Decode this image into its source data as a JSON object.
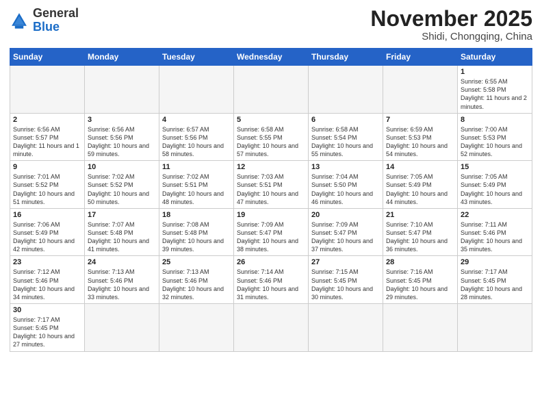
{
  "logo": {
    "general": "General",
    "blue": "Blue"
  },
  "title": "November 2025",
  "location": "Shidi, Chongqing, China",
  "weekdays": [
    "Sunday",
    "Monday",
    "Tuesday",
    "Wednesday",
    "Thursday",
    "Friday",
    "Saturday"
  ],
  "days": [
    {
      "date": "",
      "info": ""
    },
    {
      "date": "",
      "info": ""
    },
    {
      "date": "",
      "info": ""
    },
    {
      "date": "",
      "info": ""
    },
    {
      "date": "",
      "info": ""
    },
    {
      "date": "",
      "info": ""
    },
    {
      "date": "1",
      "info": "Sunrise: 6:55 AM\nSunset: 5:58 PM\nDaylight: 11 hours and 2 minutes."
    },
    {
      "date": "2",
      "info": "Sunrise: 6:56 AM\nSunset: 5:57 PM\nDaylight: 11 hours and 1 minute."
    },
    {
      "date": "3",
      "info": "Sunrise: 6:56 AM\nSunset: 5:56 PM\nDaylight: 10 hours and 59 minutes."
    },
    {
      "date": "4",
      "info": "Sunrise: 6:57 AM\nSunset: 5:56 PM\nDaylight: 10 hours and 58 minutes."
    },
    {
      "date": "5",
      "info": "Sunrise: 6:58 AM\nSunset: 5:55 PM\nDaylight: 10 hours and 57 minutes."
    },
    {
      "date": "6",
      "info": "Sunrise: 6:58 AM\nSunset: 5:54 PM\nDaylight: 10 hours and 55 minutes."
    },
    {
      "date": "7",
      "info": "Sunrise: 6:59 AM\nSunset: 5:53 PM\nDaylight: 10 hours and 54 minutes."
    },
    {
      "date": "8",
      "info": "Sunrise: 7:00 AM\nSunset: 5:53 PM\nDaylight: 10 hours and 52 minutes."
    },
    {
      "date": "9",
      "info": "Sunrise: 7:01 AM\nSunset: 5:52 PM\nDaylight: 10 hours and 51 minutes."
    },
    {
      "date": "10",
      "info": "Sunrise: 7:02 AM\nSunset: 5:52 PM\nDaylight: 10 hours and 50 minutes."
    },
    {
      "date": "11",
      "info": "Sunrise: 7:02 AM\nSunset: 5:51 PM\nDaylight: 10 hours and 48 minutes."
    },
    {
      "date": "12",
      "info": "Sunrise: 7:03 AM\nSunset: 5:51 PM\nDaylight: 10 hours and 47 minutes."
    },
    {
      "date": "13",
      "info": "Sunrise: 7:04 AM\nSunset: 5:50 PM\nDaylight: 10 hours and 46 minutes."
    },
    {
      "date": "14",
      "info": "Sunrise: 7:05 AM\nSunset: 5:49 PM\nDaylight: 10 hours and 44 minutes."
    },
    {
      "date": "15",
      "info": "Sunrise: 7:05 AM\nSunset: 5:49 PM\nDaylight: 10 hours and 43 minutes."
    },
    {
      "date": "16",
      "info": "Sunrise: 7:06 AM\nSunset: 5:49 PM\nDaylight: 10 hours and 42 minutes."
    },
    {
      "date": "17",
      "info": "Sunrise: 7:07 AM\nSunset: 5:48 PM\nDaylight: 10 hours and 41 minutes."
    },
    {
      "date": "18",
      "info": "Sunrise: 7:08 AM\nSunset: 5:48 PM\nDaylight: 10 hours and 39 minutes."
    },
    {
      "date": "19",
      "info": "Sunrise: 7:09 AM\nSunset: 5:47 PM\nDaylight: 10 hours and 38 minutes."
    },
    {
      "date": "20",
      "info": "Sunrise: 7:09 AM\nSunset: 5:47 PM\nDaylight: 10 hours and 37 minutes."
    },
    {
      "date": "21",
      "info": "Sunrise: 7:10 AM\nSunset: 5:47 PM\nDaylight: 10 hours and 36 minutes."
    },
    {
      "date": "22",
      "info": "Sunrise: 7:11 AM\nSunset: 5:46 PM\nDaylight: 10 hours and 35 minutes."
    },
    {
      "date": "23",
      "info": "Sunrise: 7:12 AM\nSunset: 5:46 PM\nDaylight: 10 hours and 34 minutes."
    },
    {
      "date": "24",
      "info": "Sunrise: 7:13 AM\nSunset: 5:46 PM\nDaylight: 10 hours and 33 minutes."
    },
    {
      "date": "25",
      "info": "Sunrise: 7:13 AM\nSunset: 5:46 PM\nDaylight: 10 hours and 32 minutes."
    },
    {
      "date": "26",
      "info": "Sunrise: 7:14 AM\nSunset: 5:46 PM\nDaylight: 10 hours and 31 minutes."
    },
    {
      "date": "27",
      "info": "Sunrise: 7:15 AM\nSunset: 5:45 PM\nDaylight: 10 hours and 30 minutes."
    },
    {
      "date": "28",
      "info": "Sunrise: 7:16 AM\nSunset: 5:45 PM\nDaylight: 10 hours and 29 minutes."
    },
    {
      "date": "29",
      "info": "Sunrise: 7:17 AM\nSunset: 5:45 PM\nDaylight: 10 hours and 28 minutes."
    },
    {
      "date": "30",
      "info": "Sunrise: 7:17 AM\nSunset: 5:45 PM\nDaylight: 10 hours and 27 minutes."
    },
    {
      "date": "",
      "info": ""
    },
    {
      "date": "",
      "info": ""
    },
    {
      "date": "",
      "info": ""
    },
    {
      "date": "",
      "info": ""
    },
    {
      "date": "",
      "info": ""
    },
    {
      "date": "",
      "info": ""
    }
  ]
}
